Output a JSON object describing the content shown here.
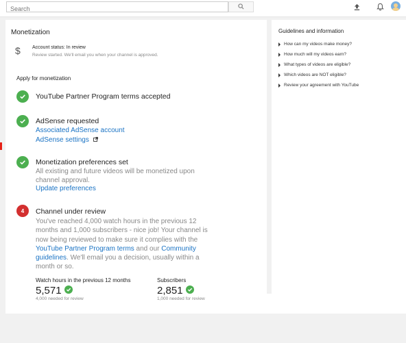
{
  "header": {
    "search_placeholder": "Search",
    "icons": [
      "search-icon",
      "upload-icon",
      "bell-icon",
      "avatar"
    ]
  },
  "monetization": {
    "title": "Monetization",
    "status": "Account status: In review",
    "status_sub": "Review started. We'll email you when your channel is approved.",
    "apply_title": "Apply for monetization",
    "step1": {
      "title": "YouTube Partner Program terms accepted"
    },
    "step2": {
      "title": "AdSense requested",
      "link1": "Associated AdSense account",
      "link2": "AdSense settings"
    },
    "step3": {
      "title": "Monetization preferences set",
      "desc": "All existing and future videos will be monetized upon channel approval.",
      "link": "Update preferences"
    },
    "step4": {
      "number": "4",
      "title": "Channel under review",
      "desc_part1": "You've reached 4,000 watch hours in the previous 12 months and 1,000 subscribers - nice job! Your channel is now being reviewed to make sure it complies with the ",
      "desc_link1": "YouTube Partner Program terms",
      "desc_part2": " and our ",
      "desc_link2": "Community guidelines",
      "desc_part3": ". We'll email you a decision, usually within a month or so."
    },
    "stats": {
      "watch_label": "Watch hours in the previous 12 months",
      "watch_value": "5,571",
      "watch_note": "4,000 needed for review",
      "subs_label": "Subscribers",
      "subs_value": "2,851",
      "subs_note": "1,000 needed for review"
    }
  },
  "guidelines": {
    "title": "Guidelines and information",
    "items": [
      "How can my videos make money?",
      "How much will my videos earn?",
      "What types of videos are eligible?",
      "Which videos are NOT eligible?",
      "Review your agreement with YouTube"
    ]
  },
  "colors": {
    "check": "#4caf50",
    "review_badge": "#d32f2f",
    "link": "#1a73c4"
  }
}
